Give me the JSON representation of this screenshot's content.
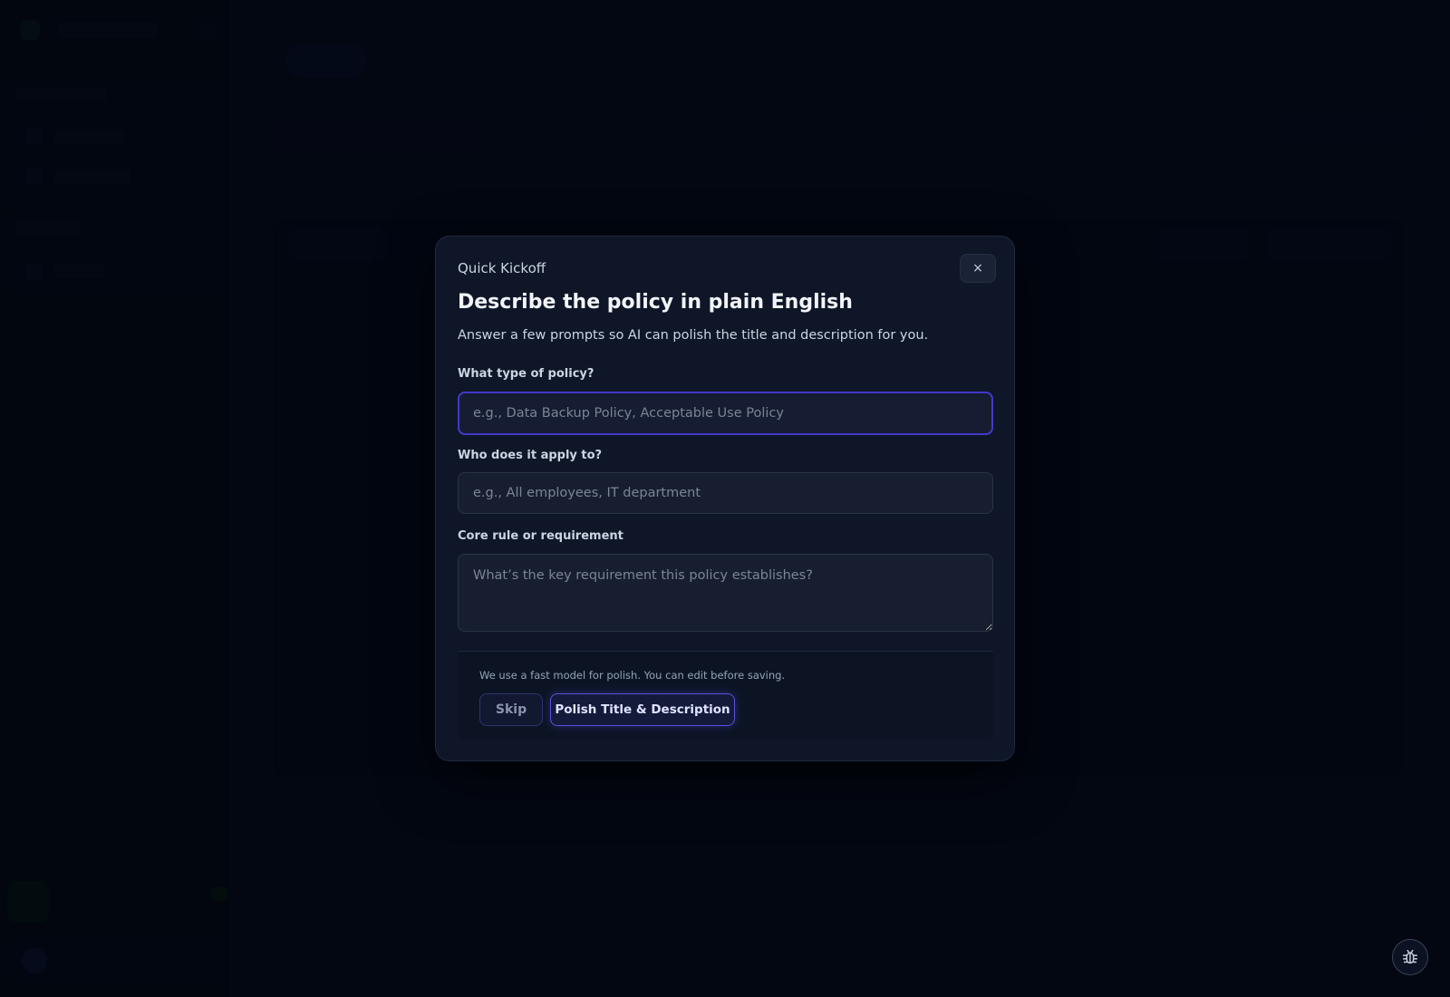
{
  "modal": {
    "kicker": "Quick Kickoff",
    "title": "Describe the policy in plain English",
    "subtitle": "Answer a few prompts so AI can polish the title and description for you.",
    "close_label": "×",
    "fields": {
      "policy_type": {
        "label": "What type of policy?",
        "value": "",
        "placeholder": "e.g., Data Backup Policy, Acceptable Use Policy"
      },
      "applies_to": {
        "label": "Who does it apply to?",
        "value": "",
        "placeholder": "e.g., All employees, IT department"
      },
      "core_rule": {
        "label": "Core rule or requirement",
        "value": "",
        "placeholder": "What’s the key requirement this policy establishes?"
      }
    },
    "footer": {
      "note": "We use a fast model for polish. You can edit before saving.",
      "skip_label": "Skip",
      "polish_label": "Polish Title & Description"
    }
  },
  "icons": {
    "debug": "bug-icon",
    "close": "close-icon"
  },
  "colors": {
    "accent": "#5b4fe0",
    "focus_border": "#4338ca",
    "modal_bg": "#0e1628",
    "page_bg": "#050a18"
  }
}
